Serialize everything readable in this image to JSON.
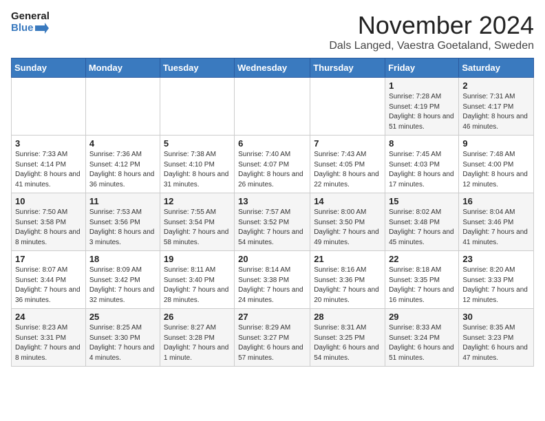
{
  "logo": {
    "text_general": "General",
    "text_blue": "Blue"
  },
  "header": {
    "title": "November 2024",
    "subtitle": "Dals Langed, Vaestra Goetaland, Sweden"
  },
  "weekdays": [
    "Sunday",
    "Monday",
    "Tuesday",
    "Wednesday",
    "Thursday",
    "Friday",
    "Saturday"
  ],
  "weeks": [
    [
      {
        "day": "",
        "info": ""
      },
      {
        "day": "",
        "info": ""
      },
      {
        "day": "",
        "info": ""
      },
      {
        "day": "",
        "info": ""
      },
      {
        "day": "",
        "info": ""
      },
      {
        "day": "1",
        "info": "Sunrise: 7:28 AM\nSunset: 4:19 PM\nDaylight: 8 hours and 51 minutes."
      },
      {
        "day": "2",
        "info": "Sunrise: 7:31 AM\nSunset: 4:17 PM\nDaylight: 8 hours and 46 minutes."
      }
    ],
    [
      {
        "day": "3",
        "info": "Sunrise: 7:33 AM\nSunset: 4:14 PM\nDaylight: 8 hours and 41 minutes."
      },
      {
        "day": "4",
        "info": "Sunrise: 7:36 AM\nSunset: 4:12 PM\nDaylight: 8 hours and 36 minutes."
      },
      {
        "day": "5",
        "info": "Sunrise: 7:38 AM\nSunset: 4:10 PM\nDaylight: 8 hours and 31 minutes."
      },
      {
        "day": "6",
        "info": "Sunrise: 7:40 AM\nSunset: 4:07 PM\nDaylight: 8 hours and 26 minutes."
      },
      {
        "day": "7",
        "info": "Sunrise: 7:43 AM\nSunset: 4:05 PM\nDaylight: 8 hours and 22 minutes."
      },
      {
        "day": "8",
        "info": "Sunrise: 7:45 AM\nSunset: 4:03 PM\nDaylight: 8 hours and 17 minutes."
      },
      {
        "day": "9",
        "info": "Sunrise: 7:48 AM\nSunset: 4:00 PM\nDaylight: 8 hours and 12 minutes."
      }
    ],
    [
      {
        "day": "10",
        "info": "Sunrise: 7:50 AM\nSunset: 3:58 PM\nDaylight: 8 hours and 8 minutes."
      },
      {
        "day": "11",
        "info": "Sunrise: 7:53 AM\nSunset: 3:56 PM\nDaylight: 8 hours and 3 minutes."
      },
      {
        "day": "12",
        "info": "Sunrise: 7:55 AM\nSunset: 3:54 PM\nDaylight: 7 hours and 58 minutes."
      },
      {
        "day": "13",
        "info": "Sunrise: 7:57 AM\nSunset: 3:52 PM\nDaylight: 7 hours and 54 minutes."
      },
      {
        "day": "14",
        "info": "Sunrise: 8:00 AM\nSunset: 3:50 PM\nDaylight: 7 hours and 49 minutes."
      },
      {
        "day": "15",
        "info": "Sunrise: 8:02 AM\nSunset: 3:48 PM\nDaylight: 7 hours and 45 minutes."
      },
      {
        "day": "16",
        "info": "Sunrise: 8:04 AM\nSunset: 3:46 PM\nDaylight: 7 hours and 41 minutes."
      }
    ],
    [
      {
        "day": "17",
        "info": "Sunrise: 8:07 AM\nSunset: 3:44 PM\nDaylight: 7 hours and 36 minutes."
      },
      {
        "day": "18",
        "info": "Sunrise: 8:09 AM\nSunset: 3:42 PM\nDaylight: 7 hours and 32 minutes."
      },
      {
        "day": "19",
        "info": "Sunrise: 8:11 AM\nSunset: 3:40 PM\nDaylight: 7 hours and 28 minutes."
      },
      {
        "day": "20",
        "info": "Sunrise: 8:14 AM\nSunset: 3:38 PM\nDaylight: 7 hours and 24 minutes."
      },
      {
        "day": "21",
        "info": "Sunrise: 8:16 AM\nSunset: 3:36 PM\nDaylight: 7 hours and 20 minutes."
      },
      {
        "day": "22",
        "info": "Sunrise: 8:18 AM\nSunset: 3:35 PM\nDaylight: 7 hours and 16 minutes."
      },
      {
        "day": "23",
        "info": "Sunrise: 8:20 AM\nSunset: 3:33 PM\nDaylight: 7 hours and 12 minutes."
      }
    ],
    [
      {
        "day": "24",
        "info": "Sunrise: 8:23 AM\nSunset: 3:31 PM\nDaylight: 7 hours and 8 minutes."
      },
      {
        "day": "25",
        "info": "Sunrise: 8:25 AM\nSunset: 3:30 PM\nDaylight: 7 hours and 4 minutes."
      },
      {
        "day": "26",
        "info": "Sunrise: 8:27 AM\nSunset: 3:28 PM\nDaylight: 7 hours and 1 minute."
      },
      {
        "day": "27",
        "info": "Sunrise: 8:29 AM\nSunset: 3:27 PM\nDaylight: 6 hours and 57 minutes."
      },
      {
        "day": "28",
        "info": "Sunrise: 8:31 AM\nSunset: 3:25 PM\nDaylight: 6 hours and 54 minutes."
      },
      {
        "day": "29",
        "info": "Sunrise: 8:33 AM\nSunset: 3:24 PM\nDaylight: 6 hours and 51 minutes."
      },
      {
        "day": "30",
        "info": "Sunrise: 8:35 AM\nSunset: 3:23 PM\nDaylight: 6 hours and 47 minutes."
      }
    ]
  ]
}
